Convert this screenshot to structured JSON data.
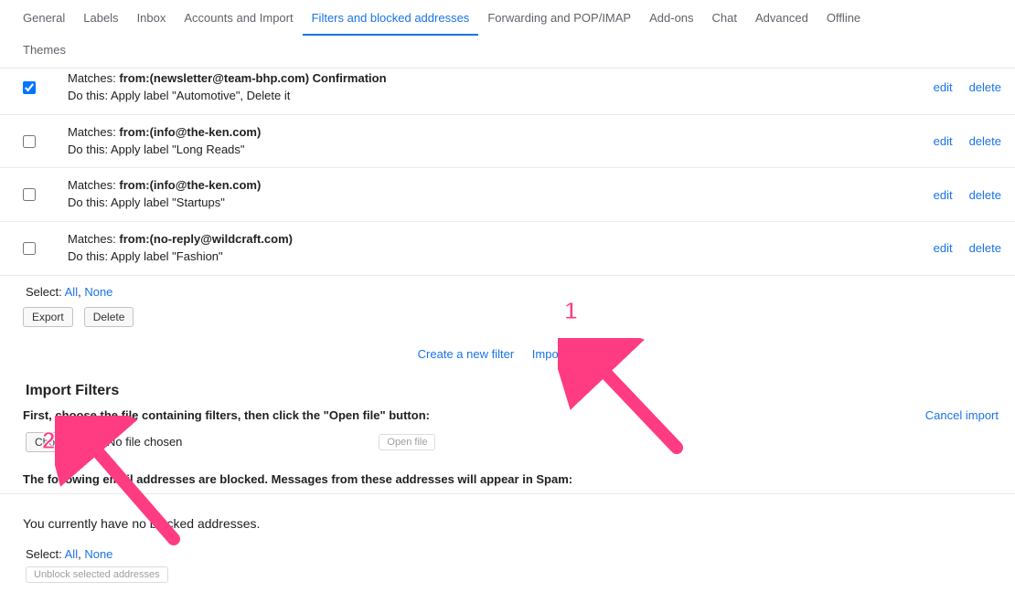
{
  "tabs": {
    "general": "General",
    "labels": "Labels",
    "inbox": "Inbox",
    "accounts": "Accounts and Import",
    "filters": "Filters and blocked addresses",
    "forwarding": "Forwarding and POP/IMAP",
    "addons": "Add-ons",
    "chat": "Chat",
    "advanced": "Advanced",
    "offline": "Offline",
    "themes": "Themes"
  },
  "filters": [
    {
      "checked": true,
      "matches_prefix": "Matches: ",
      "matches_bold": "from:(newsletter@team-bhp.com) Confirmation",
      "dothis": "Do this: Apply label \"Automotive\", Delete it",
      "edit": "edit",
      "delete": "delete"
    },
    {
      "checked": false,
      "matches_prefix": "Matches: ",
      "matches_bold": "from:(info@the-ken.com)",
      "dothis": "Do this: Apply label \"Long Reads\"",
      "edit": "edit",
      "delete": "delete"
    },
    {
      "checked": false,
      "matches_prefix": "Matches: ",
      "matches_bold": "from:(info@the-ken.com)",
      "dothis": "Do this: Apply label \"Startups\"",
      "edit": "edit",
      "delete": "delete"
    },
    {
      "checked": false,
      "matches_prefix": "Matches: ",
      "matches_bold": "from:(no-reply@wildcraft.com)",
      "dothis": "Do this: Apply label \"Fashion\"",
      "edit": "edit",
      "delete": "delete"
    }
  ],
  "select_label": "Select: ",
  "select_all": "All",
  "select_sep": ", ",
  "select_none": "None",
  "export_btn": "Export",
  "delete_btn": "Delete",
  "create_filter": "Create a new filter",
  "import_filters_link": "Import filters",
  "import_section_title": "Import Filters",
  "import_instruction": "First, choose the file containing filters, then click the \"Open file\" button:",
  "cancel_import": "Cancel import",
  "choose_file_btn": "Choose File",
  "file_status": "No file chosen",
  "open_file_btn": "Open file",
  "blocked_header": "The following email addresses are blocked. Messages from these addresses will appear in Spam:",
  "blocked_msg": "You currently have no blocked addresses.",
  "unblock_btn": "Unblock selected addresses",
  "annotations": {
    "marker1": "1",
    "marker2": "2"
  }
}
